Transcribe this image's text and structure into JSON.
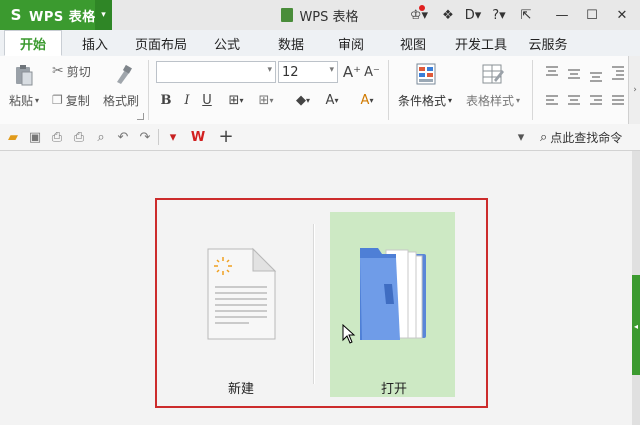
{
  "app": {
    "menu_label": "WPS 表格",
    "logo_glyph": "S",
    "caret": "▾",
    "accent": "#3b9a2f"
  },
  "window": {
    "title": "WPS 表格"
  },
  "title_controls": {
    "skin": "♔▾",
    "help": "?▾",
    "minimize": "—",
    "maximize": "☐",
    "close": "✕",
    "restore": "⇱",
    "d": "D▾",
    "shield": "❖"
  },
  "tabs": [
    "开始",
    "插入",
    "页面布局",
    "公式",
    "数据",
    "审阅",
    "视图",
    "开发工具",
    "云服务"
  ],
  "ribbon": {
    "paste": "粘贴",
    "cut": "剪切",
    "copy": "复制",
    "format_painter": "格式刷",
    "font_name": "",
    "font_size": "12",
    "bold": "B",
    "italic": "I",
    "underline": "U",
    "grow": "A⁺",
    "shrink": "A⁻",
    "conditional_format": "条件格式",
    "table_style": "表格样式",
    "font_color": "A",
    "fill_color": "◆"
  },
  "quick_access": {
    "search": "点此查找命令",
    "plus": "+"
  },
  "start": {
    "new_label": "新建",
    "open_label": "打开"
  }
}
